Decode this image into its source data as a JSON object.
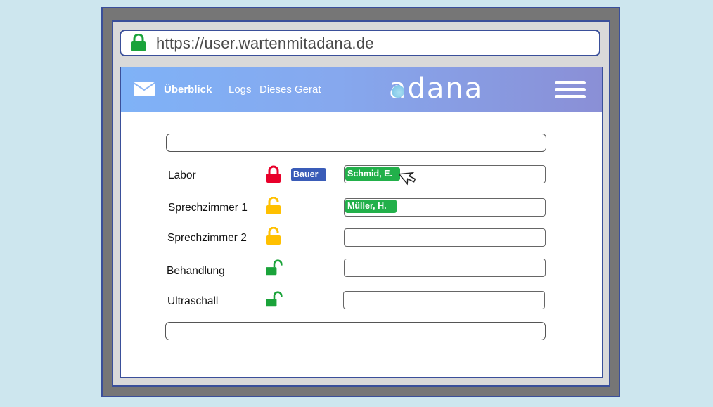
{
  "browser": {
    "url": "https://user.wartenmitadana.de",
    "lock_icon": "lock-icon",
    "lock_color": "#1aa33a"
  },
  "appbar": {
    "nav": [
      {
        "label": "Überblick",
        "active": true
      },
      {
        "label": "Logs",
        "active": false
      },
      {
        "label": "Dieses Gerät",
        "active": false
      }
    ],
    "logo": "adana",
    "gradient_start": "#7fb2f7",
    "gradient_end": "#8a8fd6"
  },
  "rooms": [
    {
      "name": "Labor",
      "lock": "closed",
      "lock_color": "#e8002a",
      "staff": "Bauer",
      "patient": "Schmid, E."
    },
    {
      "name": "Sprechzimmer 1",
      "lock": "half-open",
      "lock_color": "#ffc000",
      "staff": "",
      "patient": "Müller, H."
    },
    {
      "name": "Sprechzimmer 2",
      "lock": "half-open",
      "lock_color": "#ffc000",
      "staff": "",
      "patient": ""
    },
    {
      "name": "Behandlung",
      "lock": "open",
      "lock_color": "#1aa33a",
      "staff": "",
      "patient": ""
    },
    {
      "name": "Ultraschall",
      "lock": "open",
      "lock_color": "#1aa33a",
      "staff": "",
      "patient": ""
    }
  ],
  "colors": {
    "staff_badge": "#3a5cb8",
    "patient_badge": "#22b04a"
  }
}
